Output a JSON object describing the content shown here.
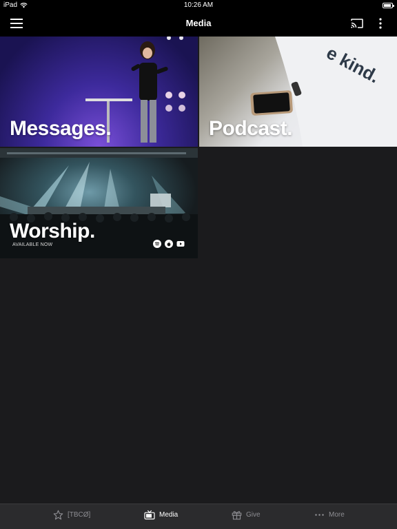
{
  "status_bar": {
    "device": "iPad",
    "time": "10:26 AM",
    "battery_level": 0.9,
    "wifi_icon": "wifi-icon",
    "battery_icon": "battery-icon"
  },
  "nav": {
    "title": "Media",
    "menu_icon": "hamburger-menu-icon",
    "cast_icon": "cast-icon",
    "more_icon": "vertical-ellipsis-icon"
  },
  "tiles": [
    {
      "label": "Messages."
    },
    {
      "label": "Podcast.",
      "overlay_text": "e kind."
    },
    {
      "label": "Worship.",
      "subtitle": "AVAILABLE NOW",
      "services": [
        "spotify-icon",
        "apple-music-icon",
        "youtube-icon"
      ]
    }
  ],
  "tab_bar": {
    "active": "Media",
    "items": [
      {
        "label": "[TBCØ]",
        "icon": "star-icon"
      },
      {
        "label": "Media",
        "icon": "tv-icon"
      },
      {
        "label": "Give",
        "icon": "gift-icon"
      },
      {
        "label": "More",
        "icon": "ellipsis-icon"
      }
    ]
  },
  "colors": {
    "background": "#1b1b1d",
    "bar": "#000000",
    "tab_bar": "#2b2b2d",
    "tab_inactive": "#8e8e93",
    "tab_active": "#ffffff"
  }
}
